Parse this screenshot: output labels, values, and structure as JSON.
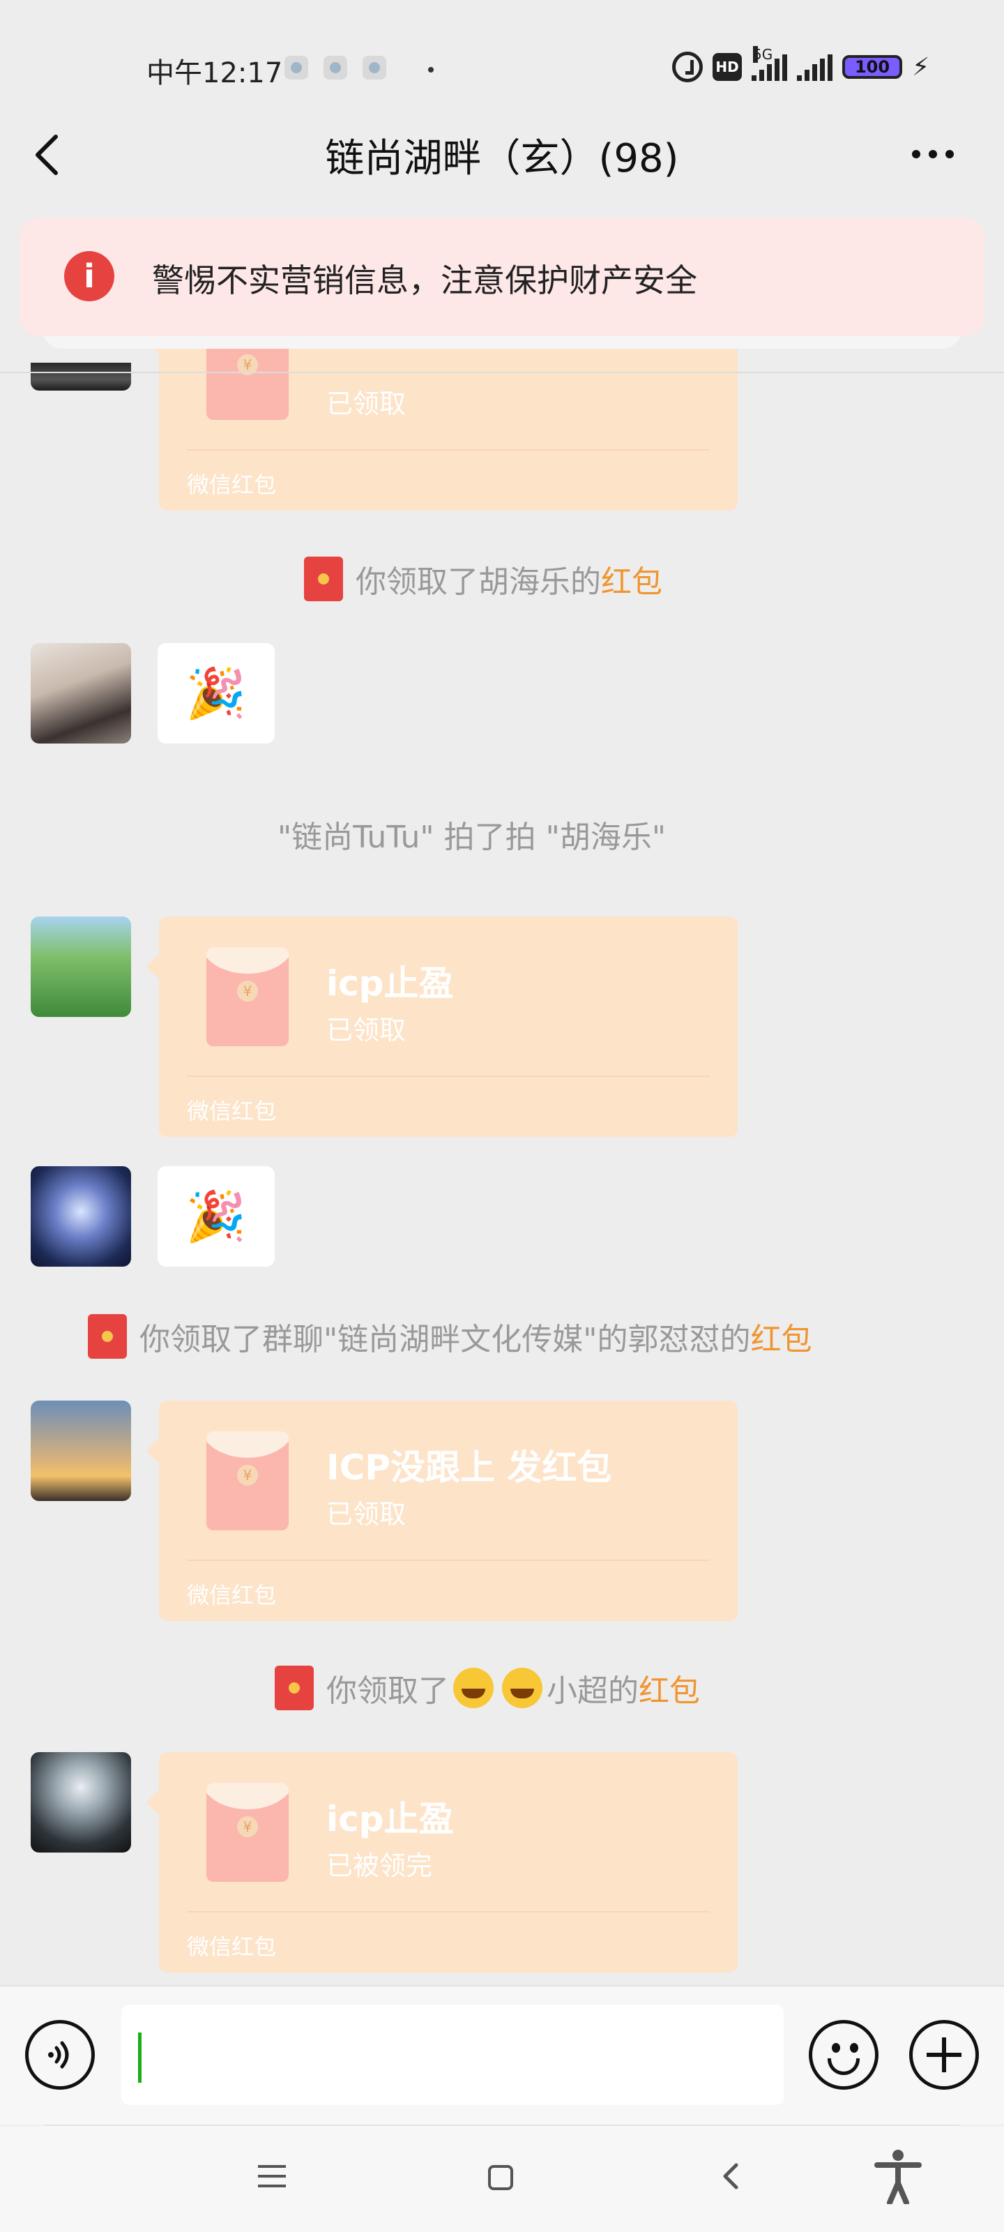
{
  "status_bar": {
    "time": "中午12:17",
    "network": "5G",
    "battery": "100",
    "icons": [
      "app-icon",
      "app-icon",
      "app-icon",
      "alarm-icon",
      "hd-icon",
      "signal-icon",
      "signal-icon",
      "battery-icon",
      "charging-icon"
    ]
  },
  "header": {
    "title": "链尚湖畔（玄）(98)",
    "back_icon": "back-arrow-icon",
    "more_icon": "more-dots-icon"
  },
  "warning": {
    "icon": "exclamation-icon",
    "text": "警惕不实营销信息，注意保护财产安全"
  },
  "messages": {
    "packet0": {
      "status": "已领取",
      "footer": "微信红包"
    },
    "sys1": {
      "prefix": "你领取了胡海乐的",
      "highlight": "红包"
    },
    "emoji1": "🎉",
    "sys2": "\"链尚TuTu\" 拍了拍 \"胡海乐\"",
    "packet1": {
      "title": "icp止盈",
      "status": "已领取",
      "footer": "微信红包"
    },
    "emoji2": "🎉",
    "sys3": {
      "prefix": "你领取了群聊\"链尚湖畔文化传媒\"的郭怼怼的",
      "highlight": "红包"
    },
    "packet2": {
      "title": "ICP没跟上  发红包",
      "status": "已领取",
      "footer": "微信红包"
    },
    "sys4": {
      "prefix": "你领取了",
      "name": "小超的",
      "highlight": "红包"
    },
    "packet3": {
      "title": "icp止盈",
      "status": "已被领完",
      "footer": "微信红包"
    }
  },
  "input_bar": {
    "voice_icon": "voice-icon",
    "text_value": "",
    "emoji_icon": "emoji-icon",
    "plus_icon": "plus-icon"
  },
  "system_nav": {
    "icons": [
      "menu-icon",
      "home-icon",
      "back-icon",
      "accessibility-icon"
    ]
  },
  "colors": {
    "background": "#ededed",
    "packet_bg": "#fde3c8",
    "highlight": "#f0952f",
    "warning_bg": "#fde7e7",
    "warning_icon": "#e64340",
    "caret": "#1aad19"
  }
}
